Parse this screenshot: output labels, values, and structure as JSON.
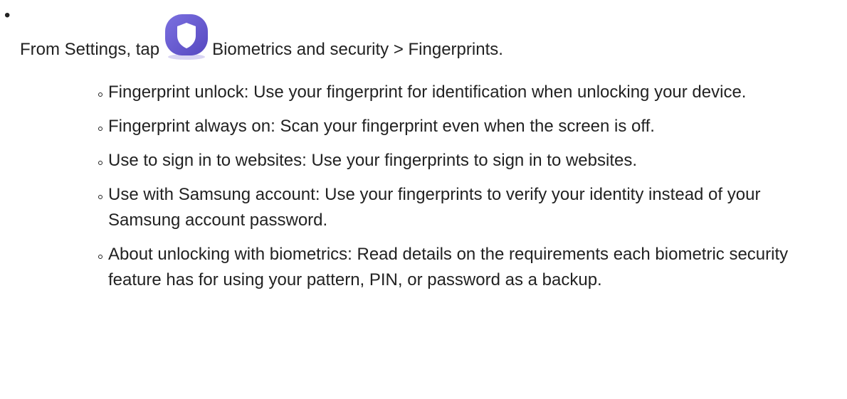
{
  "intro": {
    "prefix": "From Settings, tap",
    "icon": "shield-settings-icon",
    "path": "Biometrics and security > Fingerprints.",
    "icon_color": "#6b5fd0"
  },
  "options": [
    {
      "text": "Fingerprint unlock: Use your fingerprint for identification when unlocking your device."
    },
    {
      "text": "Fingerprint always on: Scan your fingerprint even when the screen is off."
    },
    {
      "text": "Use to sign in to websites: Use your fingerprints to sign in to websites."
    },
    {
      "text": "Use with Samsung account: Use your fingerprints to verify your identity instead of your Samsung account password."
    },
    {
      "text": "About unlocking with biometrics: Read details on the requirements each biometric security feature has for using your pattern, PIN, or password as a backup."
    }
  ]
}
